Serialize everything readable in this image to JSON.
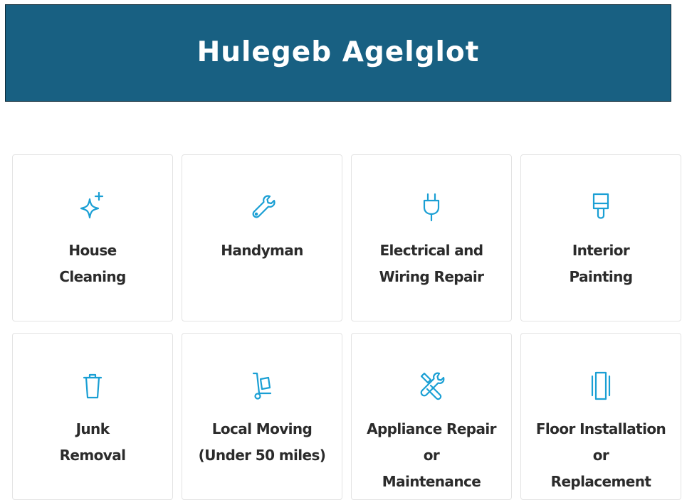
{
  "header": {
    "title": "Hulegeb Agelglot",
    "background_color": "#186082",
    "text_color": "#ffffff"
  },
  "accent_color": "#1a9fd4",
  "services": [
    {
      "line1": "House",
      "line2": "Cleaning",
      "icon": "sparkle-icon"
    },
    {
      "line1": "Handyman",
      "line2": "",
      "icon": "wrench-icon"
    },
    {
      "line1": "Electrical and",
      "line2": "Wiring Repair",
      "icon": "plug-icon"
    },
    {
      "line1": "Interior",
      "line2": "Painting",
      "icon": "paintbrush-icon"
    },
    {
      "line1": "Junk",
      "line2": "Removal",
      "icon": "trash-can-icon"
    },
    {
      "line1": "Local Moving",
      "line2": "(Under 50 miles)",
      "icon": "hand-truck-icon"
    },
    {
      "line1": "Appliance Repair or",
      "line2": "Maintenance",
      "icon": "tools-icon"
    },
    {
      "line1": "Floor Installation or",
      "line2": "Replacement",
      "icon": "floor-panels-icon"
    }
  ]
}
